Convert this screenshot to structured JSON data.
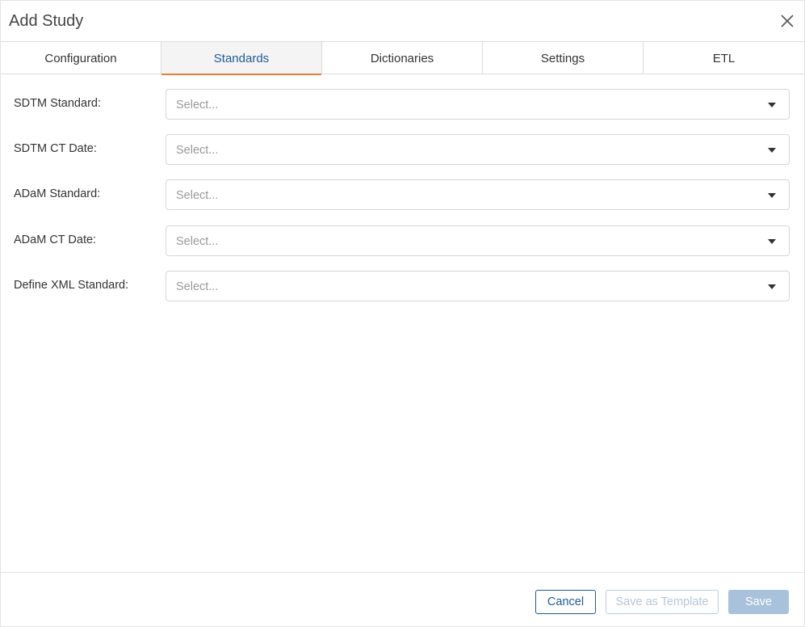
{
  "dialog": {
    "title": "Add Study",
    "close_icon": "close-icon"
  },
  "tabs": [
    {
      "label": "Configuration",
      "active": false
    },
    {
      "label": "Standards",
      "active": true
    },
    {
      "label": "Dictionaries",
      "active": false
    },
    {
      "label": "Settings",
      "active": false
    },
    {
      "label": "ETL",
      "active": false
    }
  ],
  "form": {
    "fields": [
      {
        "label": "SDTM Standard:",
        "placeholder": "Select..."
      },
      {
        "label": "SDTM CT Date:",
        "placeholder": "Select..."
      },
      {
        "label": "ADaM Standard:",
        "placeholder": "Select..."
      },
      {
        "label": "ADaM CT Date:",
        "placeholder": "Select..."
      },
      {
        "label": "Define XML Standard:",
        "placeholder": "Select..."
      }
    ]
  },
  "footer": {
    "cancel_label": "Cancel",
    "save_template_label": "Save as Template",
    "save_label": "Save"
  },
  "colors": {
    "accent_blue": "#1f5a96",
    "active_tab_underline": "#e57f3a",
    "disabled_button": "#a9c2db"
  }
}
